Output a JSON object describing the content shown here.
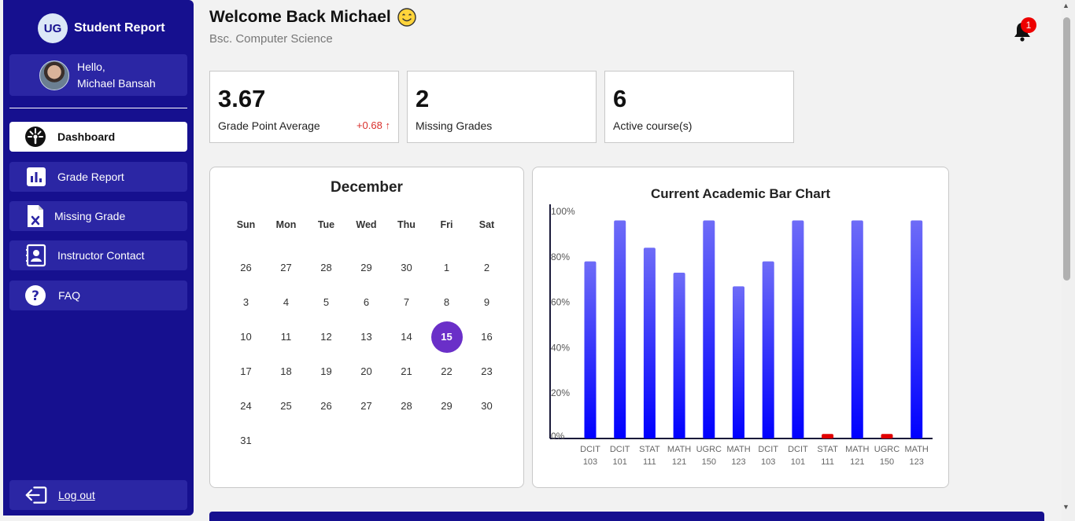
{
  "sidebar": {
    "brand_badge": "UG",
    "brand_title": "Student Report",
    "greeting": "Hello,",
    "user_name": "Michael Bansah",
    "items": [
      {
        "label": "Dashboard",
        "icon": "gauge-icon",
        "active": true
      },
      {
        "label": "Grade Report",
        "icon": "bar-chart-icon",
        "active": false
      },
      {
        "label": "Missing Grade",
        "icon": "document-x-icon",
        "active": false
      },
      {
        "label": "Instructor Contact",
        "icon": "contact-card-icon",
        "active": false
      },
      {
        "label": "FAQ",
        "icon": "question-icon",
        "active": false
      }
    ],
    "logout_label": "Log out"
  },
  "header": {
    "welcome": "Welcome Back Michael",
    "program": "Bsc. Computer Science",
    "notification_count": "1"
  },
  "stats": [
    {
      "value": "3.67",
      "label": "Grade Point Average",
      "delta": "+0.68"
    },
    {
      "value": "2",
      "label": "Missing Grades",
      "delta": ""
    },
    {
      "value": "6",
      "label": "Active course(s)",
      "delta": ""
    }
  ],
  "calendar": {
    "month": "December",
    "weekdays": [
      "Sun",
      "Mon",
      "Tue",
      "Wed",
      "Thu",
      "Fri",
      "Sat"
    ],
    "weeks": [
      [
        "26",
        "27",
        "28",
        "29",
        "30",
        "1",
        "2"
      ],
      [
        "3",
        "4",
        "5",
        "6",
        "7",
        "8",
        "9"
      ],
      [
        "10",
        "11",
        "12",
        "13",
        "14",
        "15",
        "16"
      ],
      [
        "17",
        "18",
        "19",
        "20",
        "21",
        "22",
        "23"
      ],
      [
        "24",
        "25",
        "26",
        "27",
        "28",
        "29",
        "30"
      ],
      [
        "31",
        "",
        "",
        "",
        "",
        "",
        ""
      ]
    ],
    "selected_day": "15"
  },
  "chart_data": {
    "type": "bar",
    "title": "Current Academic Bar Chart",
    "xlabel": "",
    "ylabel": "",
    "ylim": [
      0,
      100
    ],
    "yticks": [
      "0%",
      "20%",
      "40%",
      "60%",
      "80%",
      "100%"
    ],
    "categories": [
      [
        "DCIT",
        "103"
      ],
      [
        "DCIT",
        "101"
      ],
      [
        "STAT",
        "111"
      ],
      [
        "MATH",
        "121"
      ],
      [
        "UGRC",
        "150"
      ],
      [
        "MATH",
        "123"
      ],
      [
        "DCIT",
        "103"
      ],
      [
        "DCIT",
        "101"
      ],
      [
        "STAT",
        "111"
      ],
      [
        "MATH",
        "121"
      ],
      [
        "UGRC",
        "150"
      ],
      [
        "MATH",
        "123"
      ]
    ],
    "values": [
      78,
      96,
      84,
      73,
      96,
      67,
      78,
      96,
      2,
      96,
      2,
      96
    ],
    "bar_colors": [
      "#4a44ff",
      "#4a44ff",
      "#4a44ff",
      "#4a44ff",
      "#4a44ff",
      "#4a44ff",
      "#4a44ff",
      "#4a44ff",
      "#e00000",
      "#4a44ff",
      "#e00000",
      "#4a44ff"
    ],
    "grid": false
  },
  "colors": {
    "sidebar": "#16108f",
    "accent": "#6a2fc8",
    "delta": "#d9302c",
    "alert": "#e00000"
  }
}
